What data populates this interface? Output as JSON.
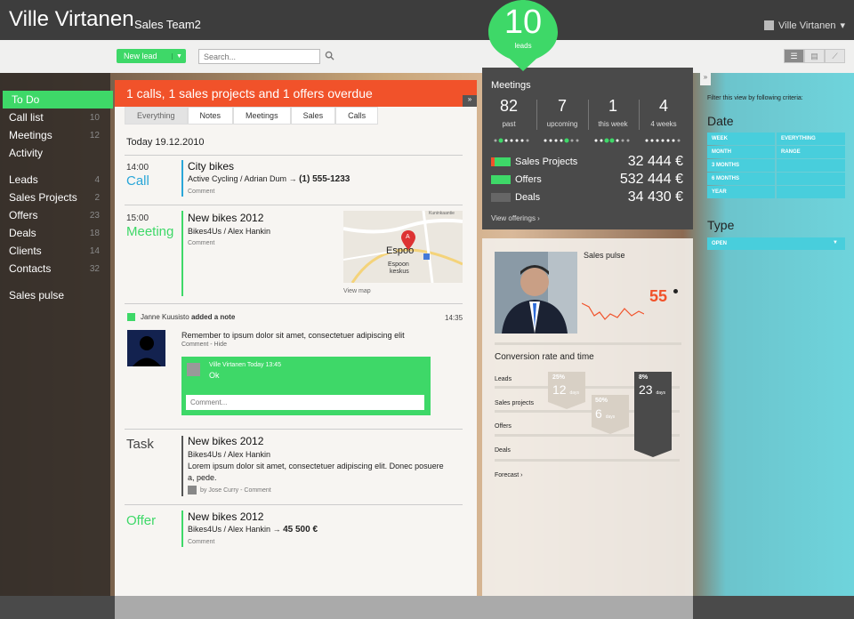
{
  "header": {
    "title": "Ville Virtanen",
    "subtitle": "Sales Team2",
    "user": "Ville Virtanen"
  },
  "toolbar": {
    "new_lead": "New lead",
    "search_placeholder": "Search..."
  },
  "nav": {
    "items": [
      {
        "label": "To Do",
        "count": ""
      },
      {
        "label": "Call list",
        "count": "10"
      },
      {
        "label": "Meetings",
        "count": "12"
      },
      {
        "label": "Activity",
        "count": ""
      },
      {
        "label": "Leads",
        "count": "4"
      },
      {
        "label": "Sales Projects",
        "count": "2"
      },
      {
        "label": "Offers",
        "count": "23"
      },
      {
        "label": "Deals",
        "count": "18"
      },
      {
        "label": "Clients",
        "count": "14"
      },
      {
        "label": "Contacts",
        "count": "32"
      },
      {
        "label": "Sales pulse",
        "count": ""
      }
    ]
  },
  "feed": {
    "overdue": "1 calls, 1 sales projects and 1 offers overdue",
    "tabs": [
      "Everything",
      "Notes",
      "Meetings",
      "Sales",
      "Calls"
    ],
    "date": "Today 19.12.2010",
    "call": {
      "time": "14:00",
      "kind": "Call",
      "title": "City bikes",
      "sub": "Active Cycling / Adrian Dum",
      "arrow": "→",
      "phone": "(1) 555-1233",
      "comment": "Comment"
    },
    "meeting": {
      "time": "15:00",
      "kind": "Meeting",
      "title": "New bikes 2012",
      "sub": "Bikes4Us / Alex Hankin",
      "comment": "Comment",
      "map_label": "Espoo",
      "map_sub1": "Espoon",
      "map_sub2": "keskus",
      "map_street": "Kuninkaantie",
      "view_map": "View map"
    },
    "note": {
      "author": "Janne Kuusisto",
      "action": "added a note",
      "time": "14:35",
      "text": "Remember to ipsum dolor sit amet, consectetuer adipiscing elit",
      "links": "Comment - Hide",
      "reply_name": "Ville Virtanen",
      "reply_time": "Today 13:45",
      "reply_text": "Ok",
      "comment_placeholder": "Comment..."
    },
    "task": {
      "kind": "Task",
      "title": "New bikes 2012",
      "sub": "Bikes4Us / Alex Hankin",
      "body": "Lorem ipsum dolor sit amet, consectetuer adipiscing elit. Donec posuere a, pede.",
      "by": "by Jose Curry - Comment"
    },
    "offer": {
      "kind": "Offer",
      "title": "New bikes 2012",
      "sub": "Bikes4Us / Alex Hankin",
      "arrow": "→",
      "amount": "45 500 €",
      "comment": "Comment"
    }
  },
  "leads_badge": {
    "count": "10",
    "label": "leads"
  },
  "meetings": {
    "title": "Meetings",
    "stats": [
      {
        "n": "82",
        "l": "past"
      },
      {
        "n": "7",
        "l": "upcoming"
      },
      {
        "n": "1",
        "l": "this week"
      },
      {
        "n": "4",
        "l": "4 weeks"
      }
    ],
    "rows": [
      {
        "label": "Sales Projects",
        "value": "32 444 €",
        "color": "#3ed868"
      },
      {
        "label": "Offers",
        "value": "532 444 €",
        "color": "#3ed868"
      },
      {
        "label": "Deals",
        "value": "34 430 €",
        "color": "#666666"
      }
    ],
    "view": "View offerings ›"
  },
  "pulse": {
    "title": "Sales pulse",
    "value": "55",
    "conv_title": "Conversion rate and time",
    "rows": [
      "Leads",
      "Sales projects",
      "Offers",
      "Deals"
    ],
    "funnel": [
      {
        "pct": "25%",
        "days": "12",
        "unit": "days"
      },
      {
        "pct": "50%",
        "days": "6",
        "unit": "days"
      },
      {
        "pct": "8%",
        "days": "23",
        "unit": "days"
      }
    ],
    "forecast": "Forecast ›"
  },
  "filter": {
    "hint": "Filter this view by following criteria:",
    "date_title": "Date",
    "cells": [
      "WEEK",
      "EVERYTHING",
      "MONTH",
      "RANGE",
      "3 MONTHS",
      "",
      "6 MONTHS",
      "",
      "YEAR",
      ""
    ],
    "type_title": "Type",
    "type_value": "OPEN"
  },
  "colors": {
    "accent": "#3ed868",
    "alert": "#f1522a",
    "filter": "#48cedc",
    "call": "#2aa6d8"
  }
}
